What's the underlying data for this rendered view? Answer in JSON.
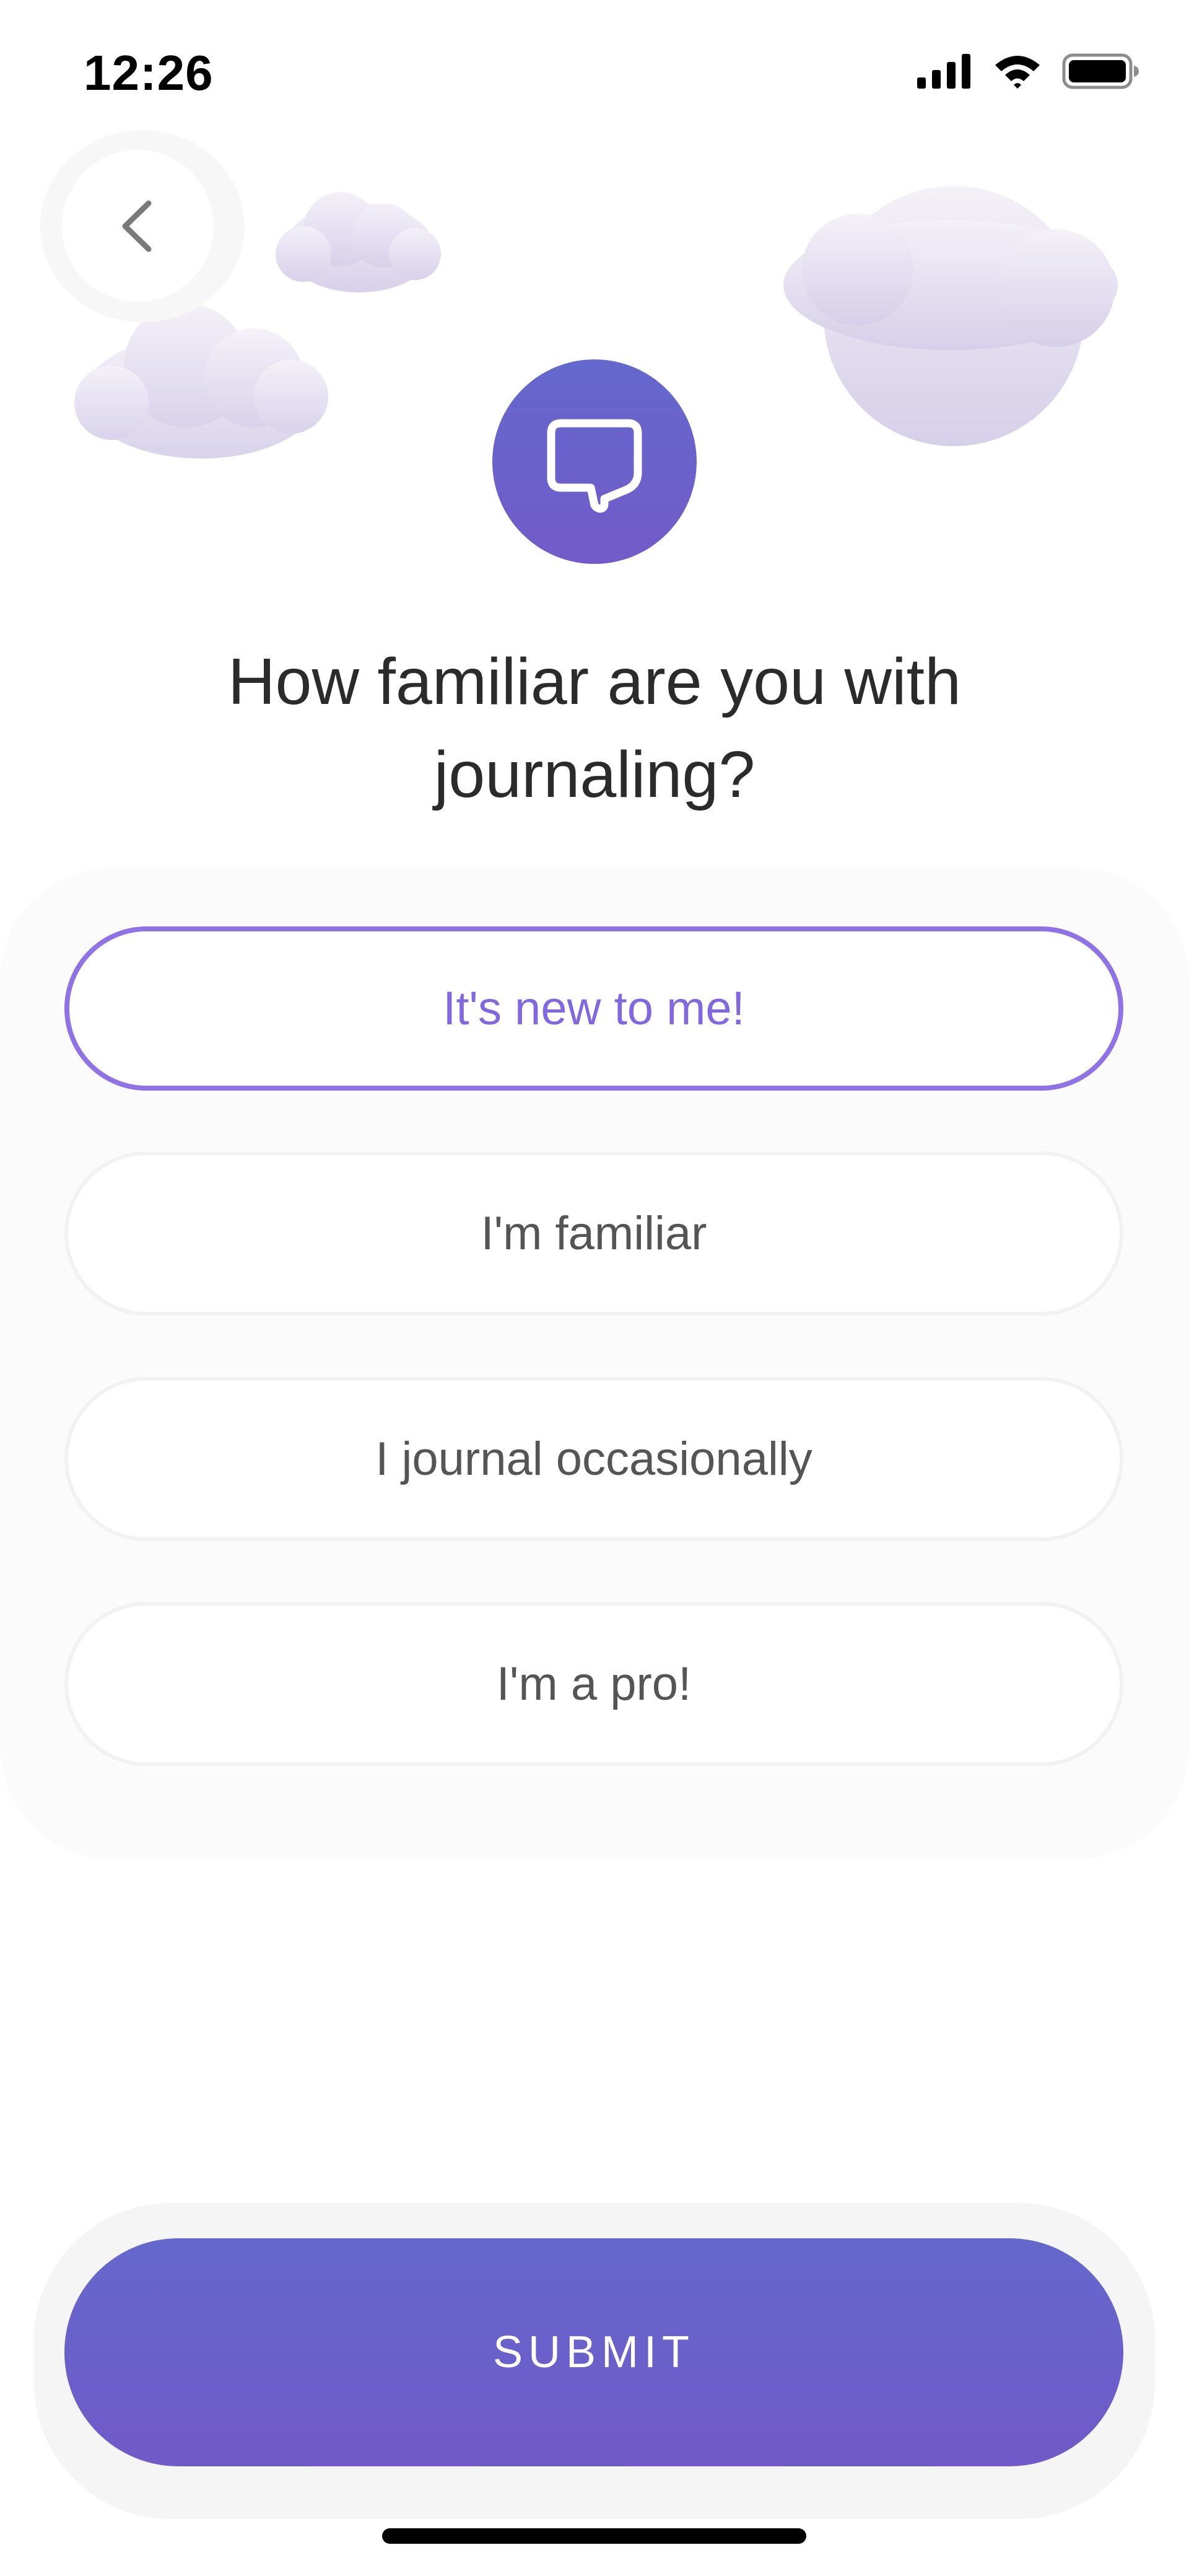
{
  "status_bar": {
    "time": "12:26"
  },
  "icons": {
    "back": "chevron-left-icon",
    "signal": "cellular-signal-icon",
    "wifi": "wifi-icon",
    "battery": "battery-icon",
    "chat": "speech-bubble-icon"
  },
  "colors": {
    "accent": "#8f72e6",
    "gradient_top": "#6468cc",
    "gradient_bottom": "#725bc9",
    "cloud": "#e2dcef"
  },
  "question": "How familiar are you with journaling?",
  "options": [
    {
      "label": "It's new to me!",
      "selected": true
    },
    {
      "label": "I'm familiar",
      "selected": false
    },
    {
      "label": "I journal occasionally",
      "selected": false
    },
    {
      "label": "I'm a pro!",
      "selected": false
    }
  ],
  "submit_label": "SUBMIT"
}
